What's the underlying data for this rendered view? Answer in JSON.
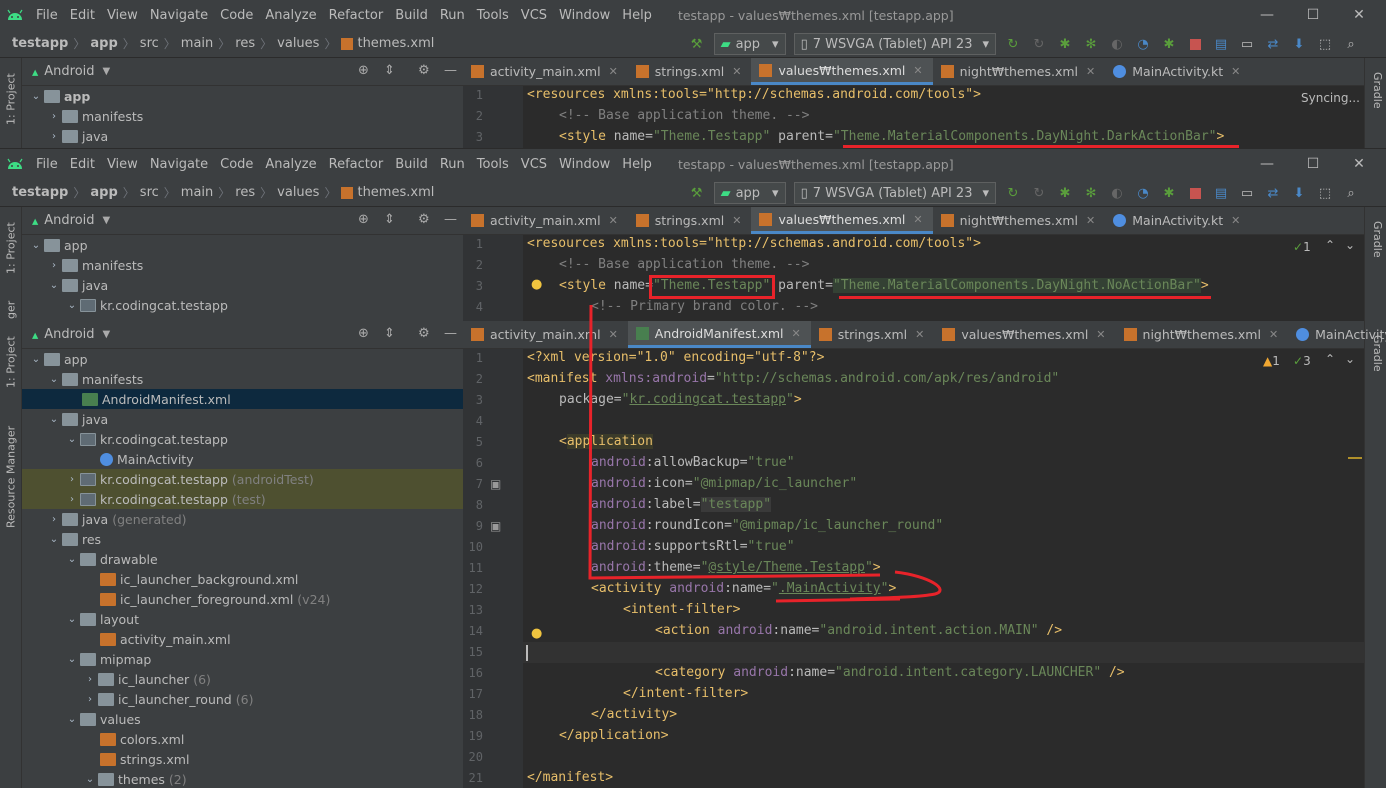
{
  "menu": {
    "items": [
      "File",
      "Edit",
      "View",
      "Navigate",
      "Code",
      "Analyze",
      "Refactor",
      "Build",
      "Run",
      "Tools",
      "VCS",
      "Window",
      "Help"
    ],
    "title": "testapp - values₩themes.xml [testapp.app]"
  },
  "breadcrumb_top": [
    "testapp",
    "app",
    "src",
    "main",
    "res",
    "values",
    "themes.xml"
  ],
  "breadcrumb_mid": [
    "testapp",
    "app",
    "src",
    "main",
    "res",
    "values",
    "themes.xml"
  ],
  "toolbar": {
    "config": "app",
    "device": "7  WSVGA (Tablet) API 23"
  },
  "sidepanel": {
    "project_tab": "1: Project",
    "resource_tab": "Resource Manager",
    "gradle_tab": "Gradle",
    "view": "Android",
    "partial_label": "ger"
  },
  "tabs_values": [
    {
      "label": "activity_main.xml"
    },
    {
      "label": "strings.xml"
    },
    {
      "label": "values₩themes.xml"
    },
    {
      "label": "night₩themes.xml"
    },
    {
      "label": "MainActivity.kt"
    }
  ],
  "tabs_manifest": [
    {
      "label": "activity_main.xml"
    },
    {
      "label": "AndroidManifest.xml"
    },
    {
      "label": "strings.xml"
    },
    {
      "label": "values₩themes.xml"
    },
    {
      "label": "night₩themes.xml"
    },
    {
      "label": "MainActivity.kt"
    }
  ],
  "editor1": {
    "syncing": "Syncing...",
    "lines": [
      "1",
      "2",
      "3"
    ]
  },
  "editor2": {
    "inspections": "1",
    "lines": [
      "1",
      "2",
      "3",
      "4"
    ]
  },
  "editor3": {
    "warnings": "1",
    "weak": "3",
    "lines": [
      "1",
      "2",
      "3",
      "4",
      "5",
      "6",
      "7",
      "8",
      "9",
      "10",
      "11",
      "12",
      "13",
      "14",
      "15",
      "16",
      "17",
      "18",
      "19",
      "20",
      "21"
    ]
  },
  "code": {
    "resources_open": "<resources xmlns:tools=\"http://schemas.android.com/tools\">",
    "comment_base": "<!-- Base application theme. -->",
    "style_name": "Theme.Testapp",
    "parent_dark": "Theme.MaterialComponents.DayNight.DarkActionBar",
    "parent_noaction": "Theme.MaterialComponents.DayNight.NoActionBar",
    "comment_primary": "<!-- Primary brand color. -->",
    "xml_decl": "<?xml version=\"1.0\" encoding=\"utf-8\"?>",
    "manifest_ns": "http://schemas.android.com/apk/res/android",
    "package": "kr.codingcat.testapp",
    "allowBackup": "true",
    "icon": "@mipmap/ic_launcher",
    "label": "testapp",
    "roundIcon": "@mipmap/ic_launcher_round",
    "supportsRtl": "true",
    "theme": "@style/Theme.Testapp",
    "activity_name": ".MainActivity",
    "action_name": "android.intent.action.MAIN",
    "category_name": "android.intent.category.LAUNCHER"
  },
  "tree_top": [
    {
      "label": "app",
      "bold": true
    },
    {
      "label": "manifests"
    },
    {
      "label": "java"
    }
  ],
  "tree_mid": [
    {
      "label": "app"
    },
    {
      "label": "manifests"
    },
    {
      "label": "java"
    },
    {
      "label": "kr.codingcat.testapp"
    }
  ],
  "tree_main": [
    {
      "label": "app"
    },
    {
      "label": "manifests"
    },
    {
      "label": "AndroidManifest.xml"
    },
    {
      "label": "java"
    },
    {
      "label": "kr.codingcat.testapp"
    },
    {
      "label": "MainActivity"
    },
    {
      "label": "kr.codingcat.testapp",
      "suffix": "(androidTest)"
    },
    {
      "label": "kr.codingcat.testapp",
      "suffix": "(test)"
    },
    {
      "label": "java",
      "suffix": "(generated)"
    },
    {
      "label": "res"
    },
    {
      "label": "drawable"
    },
    {
      "label": "ic_launcher_background.xml"
    },
    {
      "label": "ic_launcher_foreground.xml",
      "suffix": "(v24)"
    },
    {
      "label": "layout"
    },
    {
      "label": "activity_main.xml"
    },
    {
      "label": "mipmap"
    },
    {
      "label": "ic_launcher",
      "suffix": "(6)"
    },
    {
      "label": "ic_launcher_round",
      "suffix": "(6)"
    },
    {
      "label": "values"
    },
    {
      "label": "colors.xml"
    },
    {
      "label": "strings.xml"
    },
    {
      "label": "themes",
      "suffix": "(2)"
    }
  ]
}
